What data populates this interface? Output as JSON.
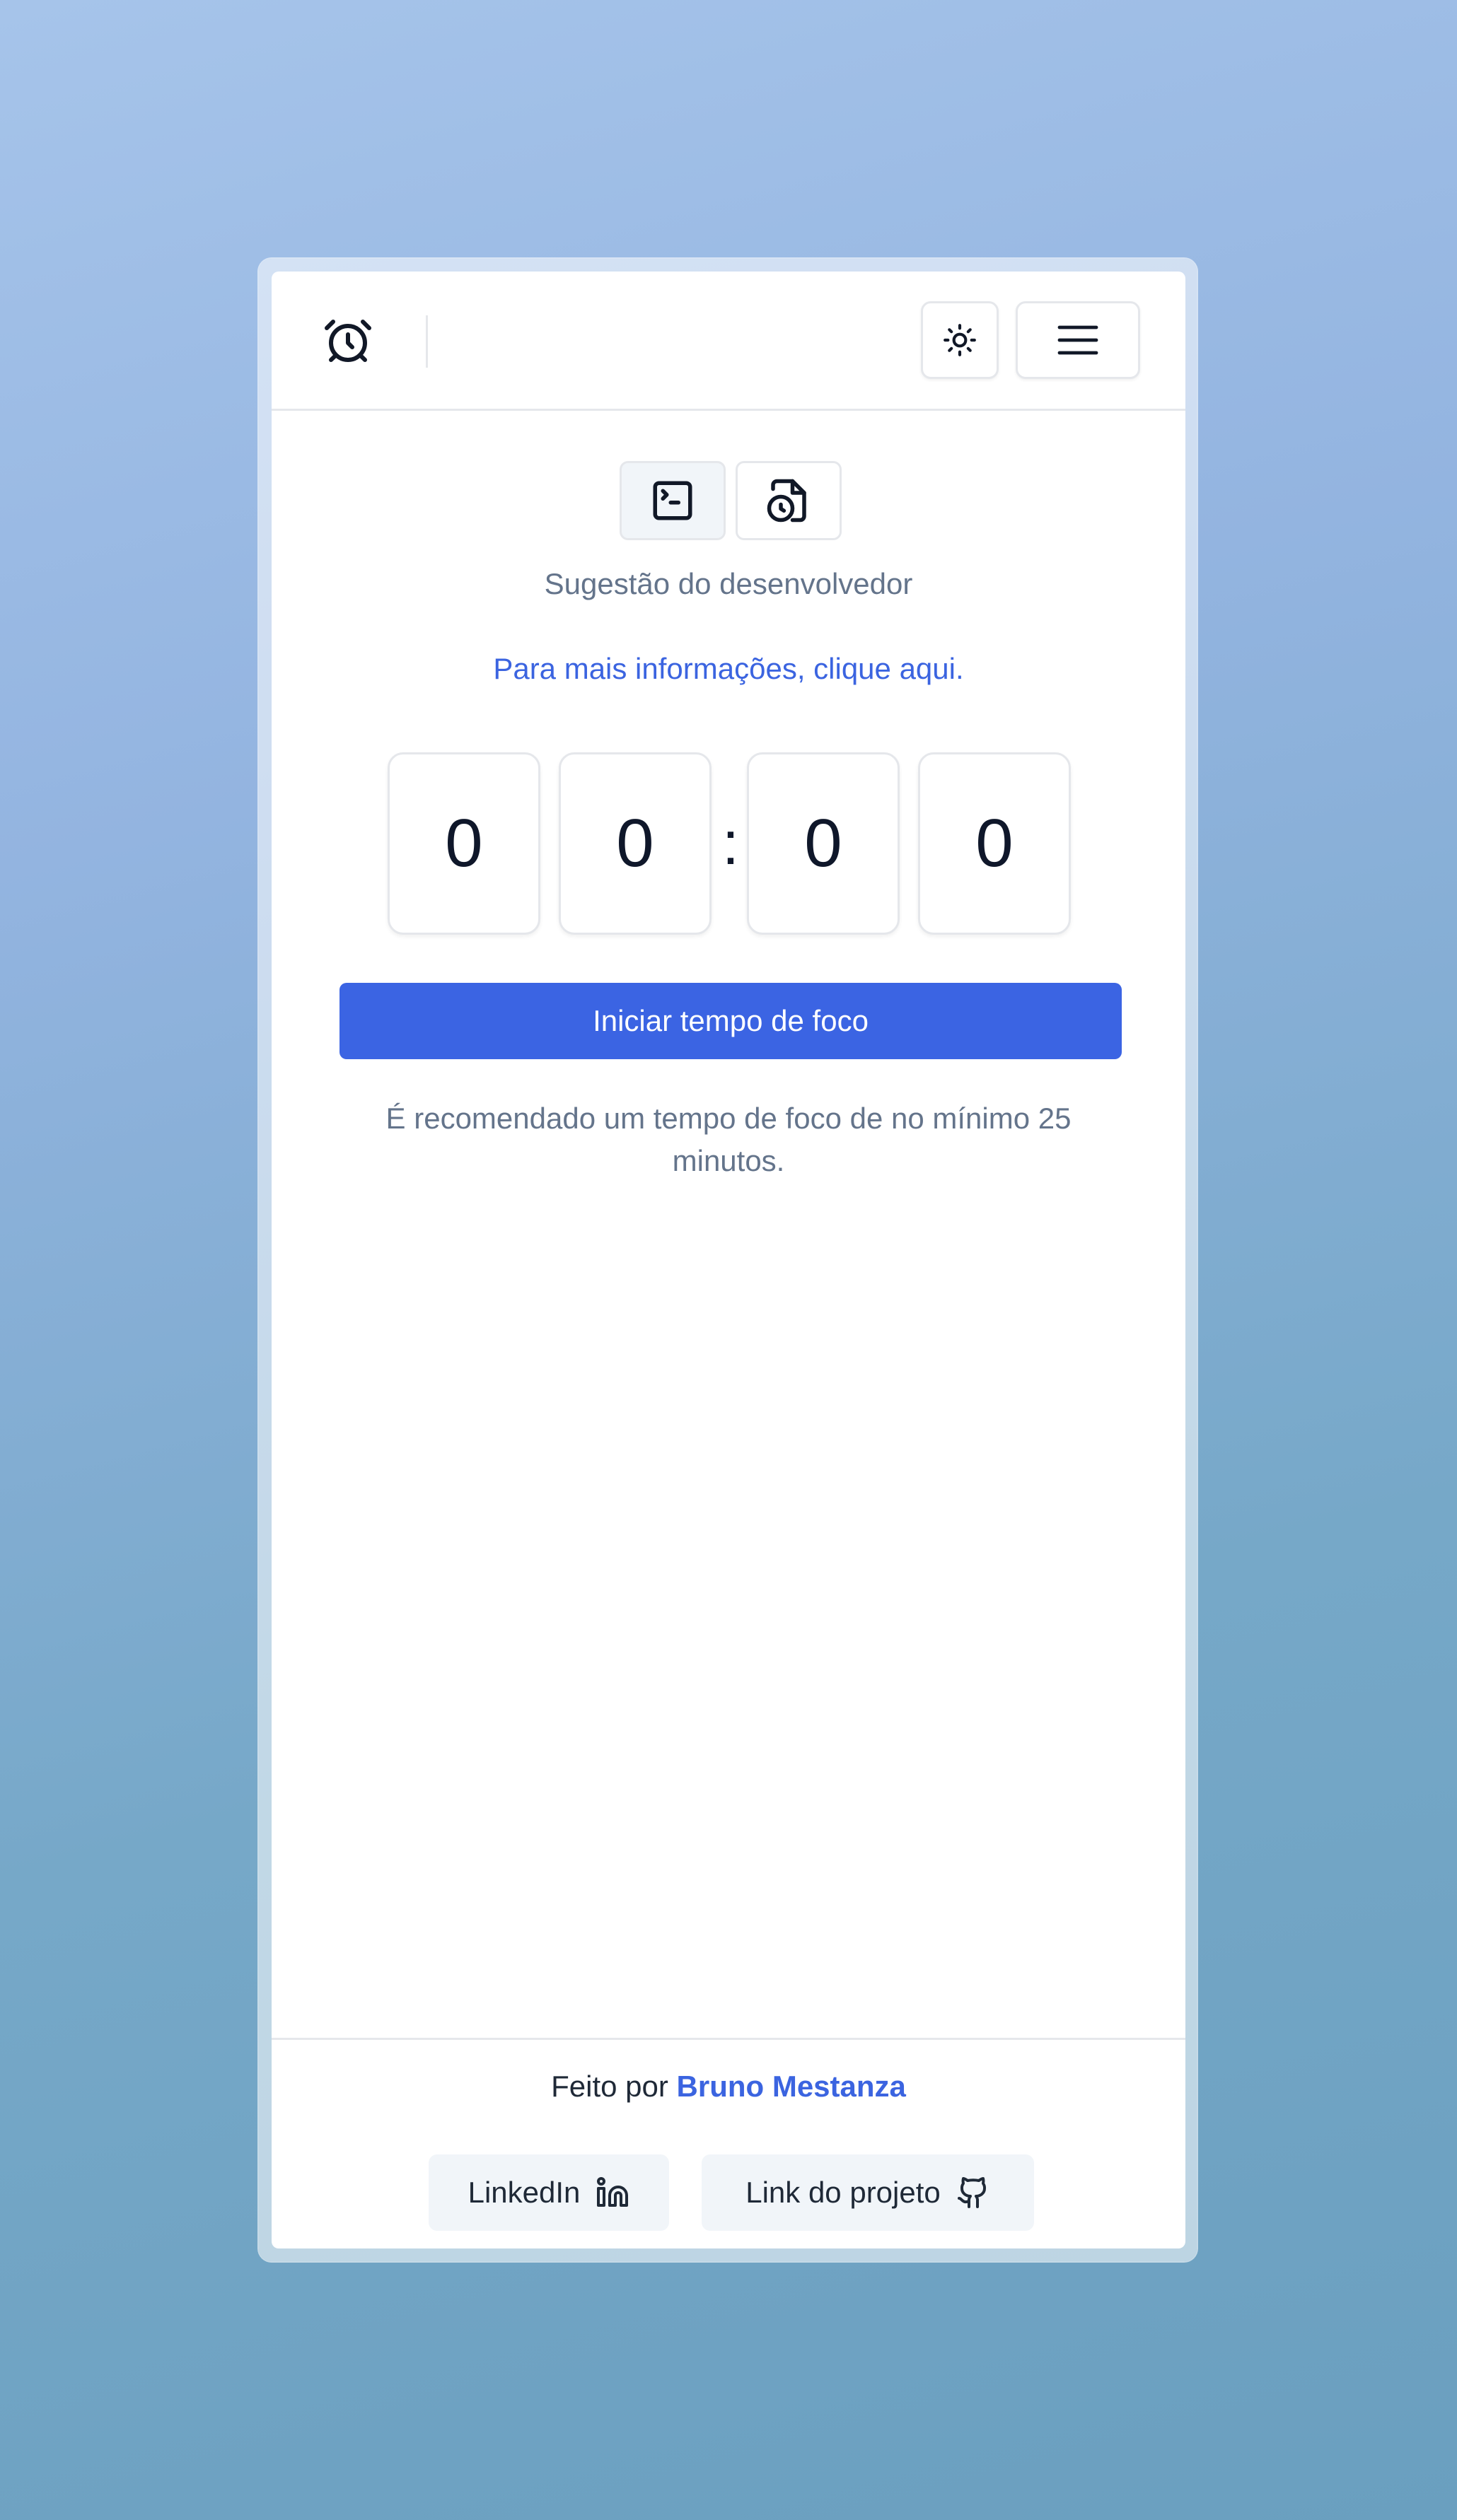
{
  "header": {
    "logo_icon": "alarm-clock-icon",
    "theme_toggle_icon": "sun-icon",
    "menu_icon": "hamburger-menu-icon"
  },
  "mode_toggle": {
    "items": [
      {
        "icon": "terminal-square-icon",
        "active": true
      },
      {
        "icon": "file-clock-icon",
        "active": false
      }
    ]
  },
  "main": {
    "subtitle": "Sugestão do desenvolvedor",
    "info_link": "Para mais informações, clique aqui.",
    "timer": {
      "digits": [
        "0",
        "0",
        "0",
        "0"
      ],
      "separator": ":"
    },
    "start_button": "Iniciar tempo de foco",
    "recommendation": "É recomendado um tempo de foco de no mínimo 25 minutos."
  },
  "footer": {
    "made_by_prefix": "Feito por",
    "author_name": "Bruno Mestanza",
    "linkedin_label": "LinkedIn",
    "linkedin_icon": "linkedin-icon",
    "project_label": "Link do projeto",
    "project_icon": "github-icon"
  },
  "colors": {
    "accent": "#3b64e3",
    "link": "#3b64e0",
    "muted_text": "#64748b",
    "border": "#e5e7eb"
  }
}
